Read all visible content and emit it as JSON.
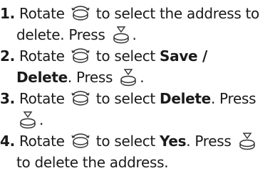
{
  "steps": [
    {
      "number": "1.",
      "line1": [
        "Rotate ",
        " to select the address to"
      ],
      "line2": [
        "delete. Press ",
        "."
      ]
    },
    {
      "number": "2.",
      "line1": [
        "Rotate ",
        " to select "
      ],
      "bold1": "Save /",
      "bold2": "Delete",
      "line2": [
        ". Press ",
        "."
      ]
    },
    {
      "number": "3.",
      "line1": [
        "Rotate ",
        " to select "
      ],
      "bold1": "Delete",
      "line1_tail": ". Press",
      "line2": [
        "."
      ]
    },
    {
      "number": "4.",
      "line1": [
        "Rotate ",
        " to select "
      ],
      "bold1": "Yes",
      "line1_tail": ". Press ",
      "line2": [
        "to delete the address."
      ]
    }
  ],
  "icons": {
    "rotate": "rotate-knob-icon",
    "press": "press-knob-icon"
  }
}
